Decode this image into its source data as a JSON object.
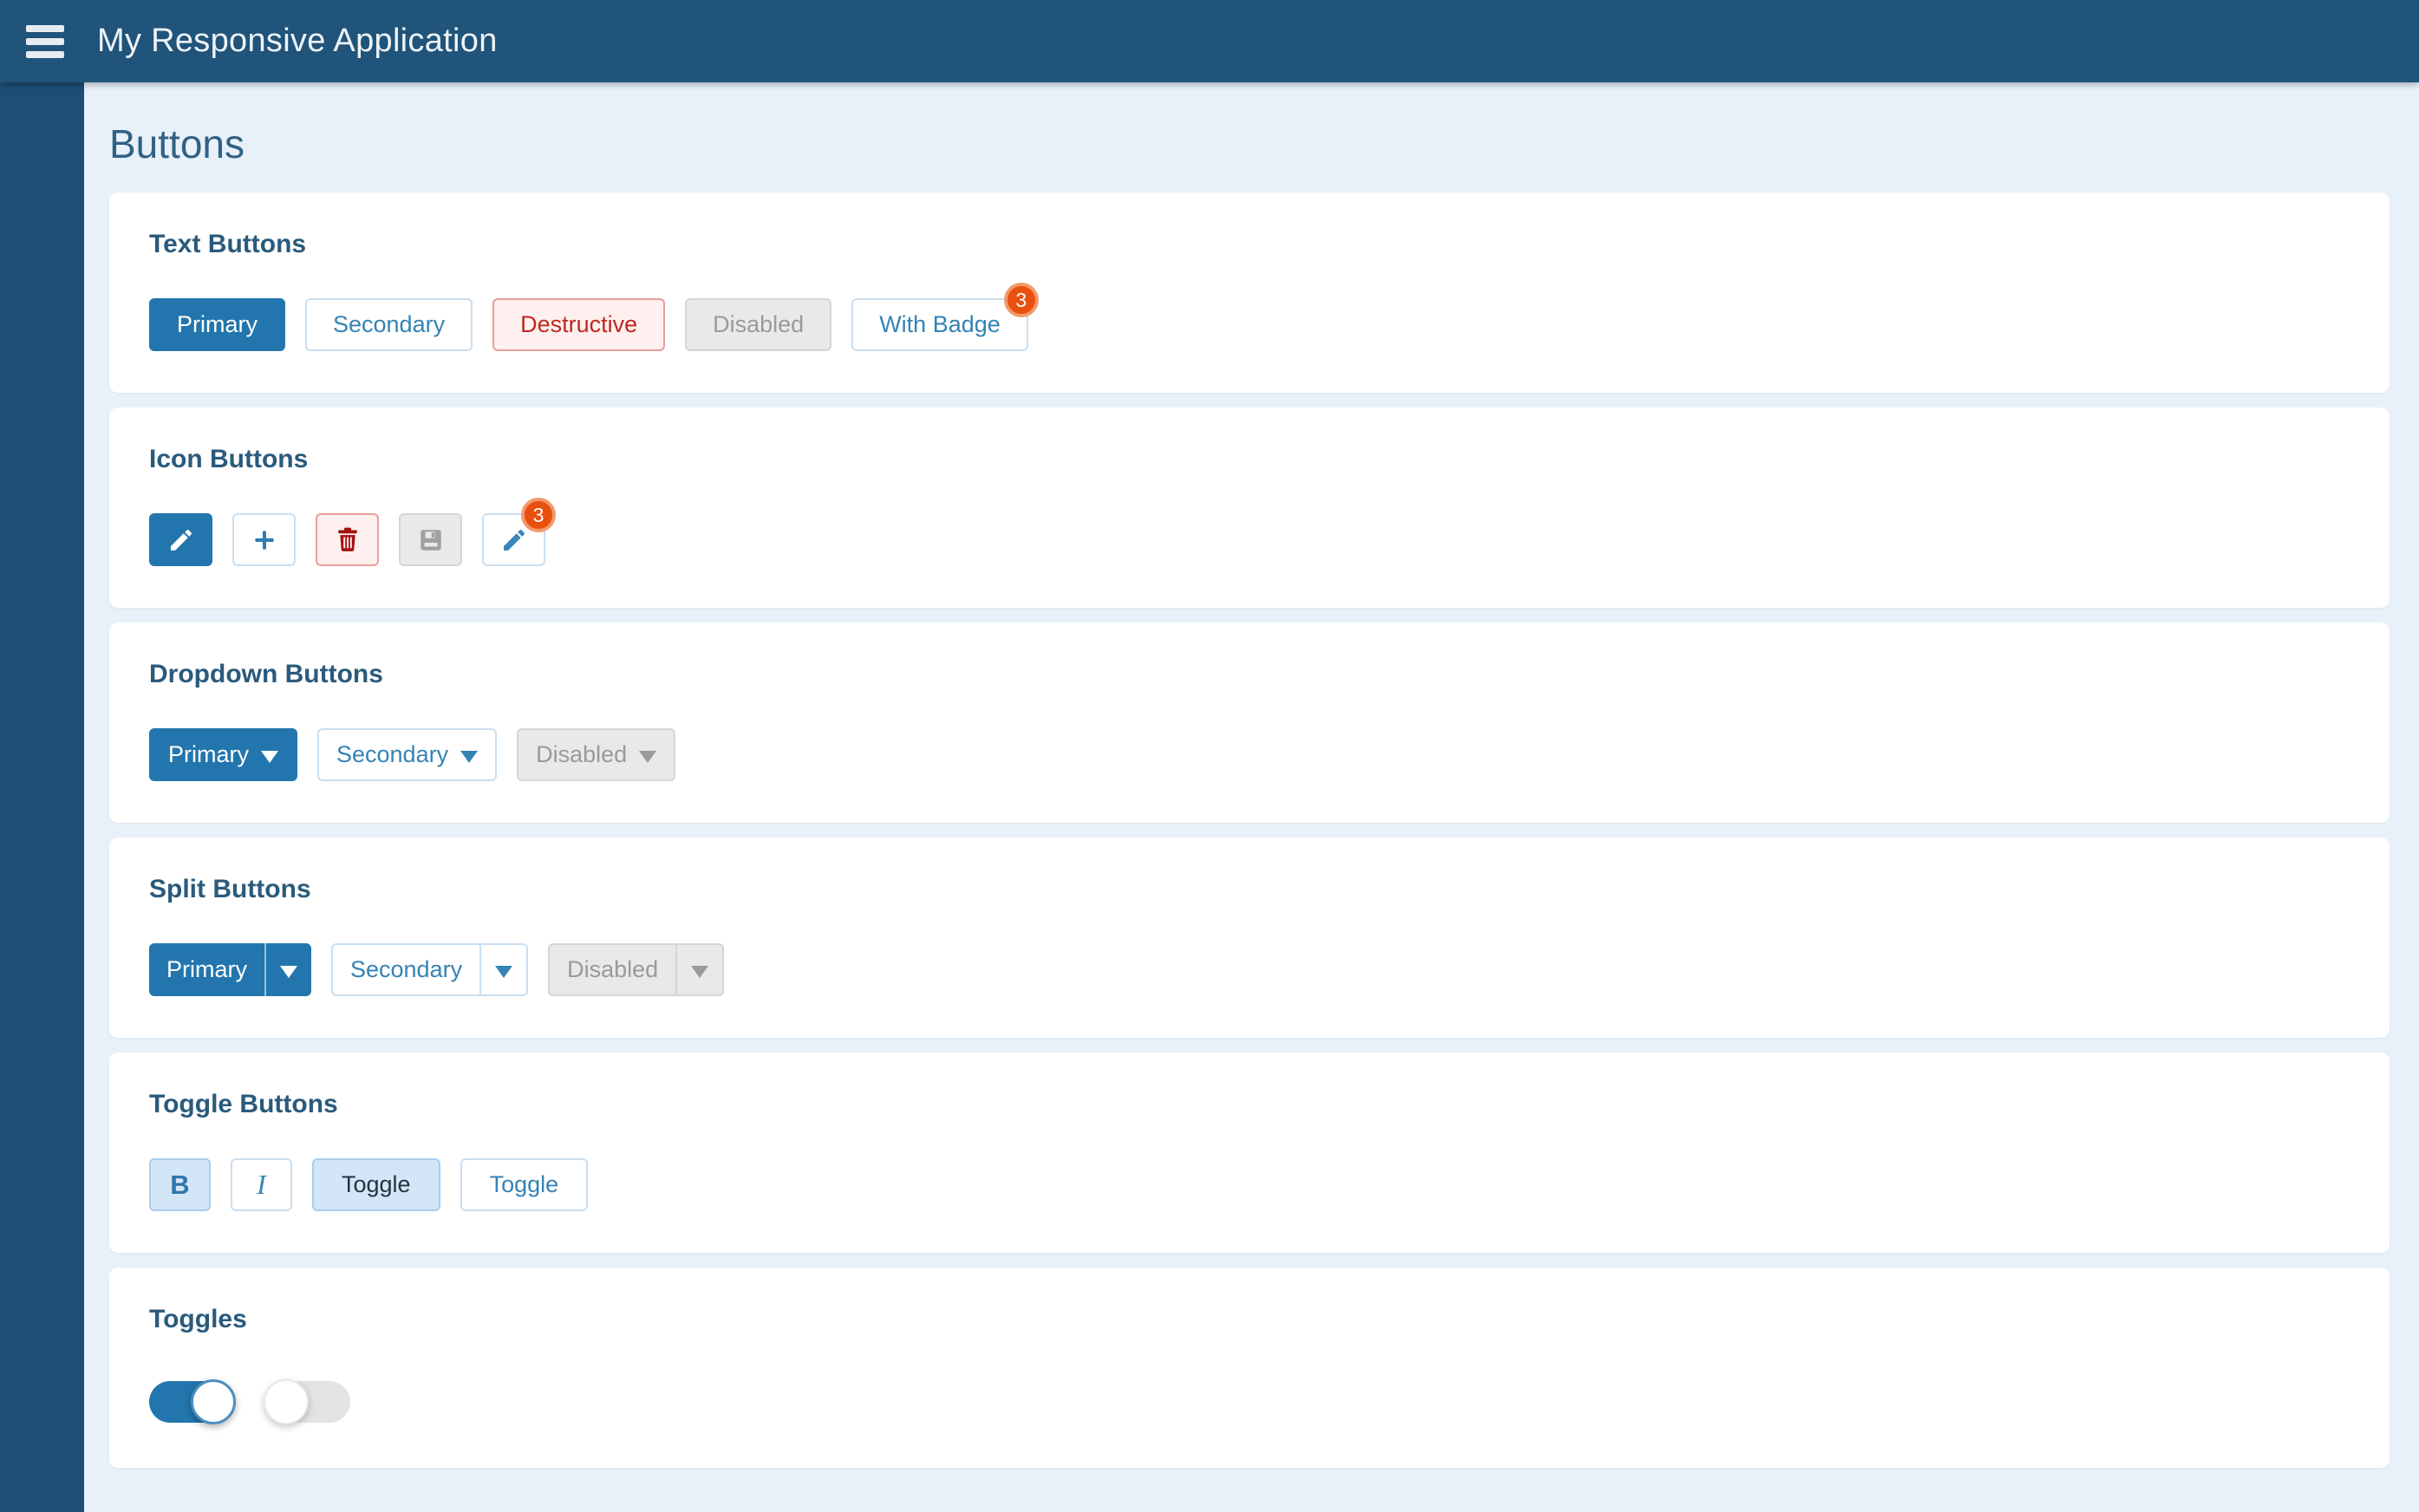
{
  "topbar": {
    "title": "My Responsive Application",
    "menu_icon": "hamburger-icon"
  },
  "page": {
    "title": "Buttons"
  },
  "colors": {
    "topbar_bg": "#20547a",
    "sidebar_bg": "#1d4f74",
    "content_bg": "#e8f1f9",
    "card_bg": "#ffffff",
    "card_heading_text": "#2a5a7c",
    "page_title_text": "#316184",
    "primary_blue": "#2376ad",
    "secondary_text_blue": "#3583b5",
    "secondary_border_blue": "#c9def0",
    "pressed_bg": "#d3e6f8",
    "pressed_border": "#a9cdec",
    "destructive_text": "#c0271e",
    "destructive_border": "#e89f99",
    "destructive_bg": "#fdf0ef",
    "disabled_bg": "#e9e9e9",
    "disabled_border": "#d5d5d5",
    "disabled_text": "#9a9a9a",
    "badge_bg": "#e8500f",
    "badge_ring": "#f2996b",
    "toggle_off_track": "#e3e3e3"
  },
  "sections": {
    "text_buttons": {
      "title": "Text Buttons",
      "buttons": [
        {
          "label": "Primary",
          "variant": "primary"
        },
        {
          "label": "Secondary",
          "variant": "secondary"
        },
        {
          "label": "Destructive",
          "variant": "destructive"
        },
        {
          "label": "Disabled",
          "variant": "disabled"
        },
        {
          "label": "With Badge",
          "variant": "secondary",
          "badge": "3"
        }
      ]
    },
    "icon_buttons": {
      "title": "Icon Buttons",
      "buttons": [
        {
          "icon": "pencil-icon",
          "variant": "primary"
        },
        {
          "icon": "plus-icon",
          "variant": "secondary"
        },
        {
          "icon": "trash-icon",
          "variant": "destructive"
        },
        {
          "icon": "save-icon",
          "variant": "disabled"
        },
        {
          "icon": "pencil-icon",
          "variant": "secondary",
          "badge": "3"
        }
      ]
    },
    "dropdown_buttons": {
      "title": "Dropdown Buttons",
      "buttons": [
        {
          "label": "Primary",
          "variant": "primary"
        },
        {
          "label": "Secondary",
          "variant": "secondary"
        },
        {
          "label": "Disabled",
          "variant": "disabled"
        }
      ]
    },
    "split_buttons": {
      "title": "Split Buttons",
      "buttons": [
        {
          "label": "Primary",
          "variant": "primary"
        },
        {
          "label": "Secondary",
          "variant": "secondary"
        },
        {
          "label": "Disabled",
          "variant": "disabled"
        }
      ]
    },
    "toggle_buttons": {
      "title": "Toggle Buttons",
      "buttons": [
        {
          "label": "B",
          "pressed": true
        },
        {
          "label": "I",
          "pressed": false
        },
        {
          "label": "Toggle",
          "pressed": true
        },
        {
          "label": "Toggle",
          "pressed": false
        }
      ]
    },
    "toggles": {
      "title": "Toggles",
      "switches": [
        {
          "state": "on"
        },
        {
          "state": "off"
        }
      ]
    }
  }
}
